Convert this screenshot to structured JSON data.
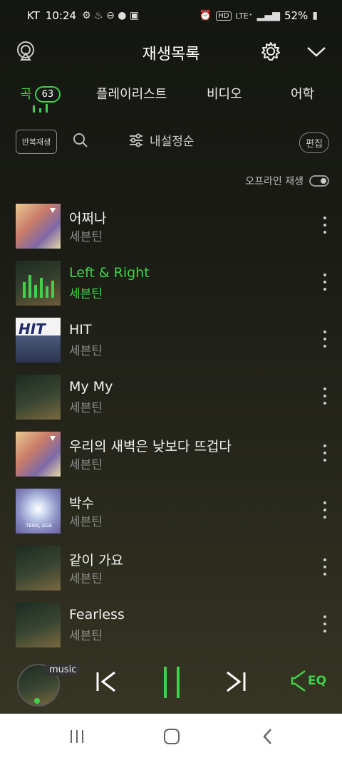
{
  "status_bar": {
    "carrier": "KT",
    "time": "10:24",
    "network": "LTE⁺",
    "hd": "HD",
    "battery": "52%"
  },
  "header": {
    "title": "재생목록"
  },
  "tabs": [
    {
      "label": "곡",
      "count": "63"
    },
    {
      "label": "플레이리스트"
    },
    {
      "label": "비디오"
    },
    {
      "label": "어학"
    }
  ],
  "toolbar": {
    "repeat_label": "반복재생",
    "sort_label": "내설정순",
    "edit_label": "편집"
  },
  "offline": {
    "label": "오프라인 재생"
  },
  "songs": [
    {
      "title": "어쩌나",
      "artist": "세븐틴"
    },
    {
      "title": "Left & Right",
      "artist": "세븐틴"
    },
    {
      "title": "HIT",
      "artist": "세븐틴"
    },
    {
      "title": "My My",
      "artist": "세븐틴"
    },
    {
      "title": "우리의 새벽은 낮보다 뜨겁다",
      "artist": "세븐틴"
    },
    {
      "title": "박수",
      "artist": "세븐틴"
    },
    {
      "title": "같이 가요",
      "artist": "세븐틴"
    },
    {
      "title": "Fearless",
      "artist": "세븐틴"
    }
  ],
  "album_art_text": {
    "hit": "HIT",
    "teen_age": "TEEN, AGE"
  },
  "player": {
    "tag": "music",
    "eq_label": "EQ"
  },
  "colors": {
    "accent": "#3fd24a"
  }
}
